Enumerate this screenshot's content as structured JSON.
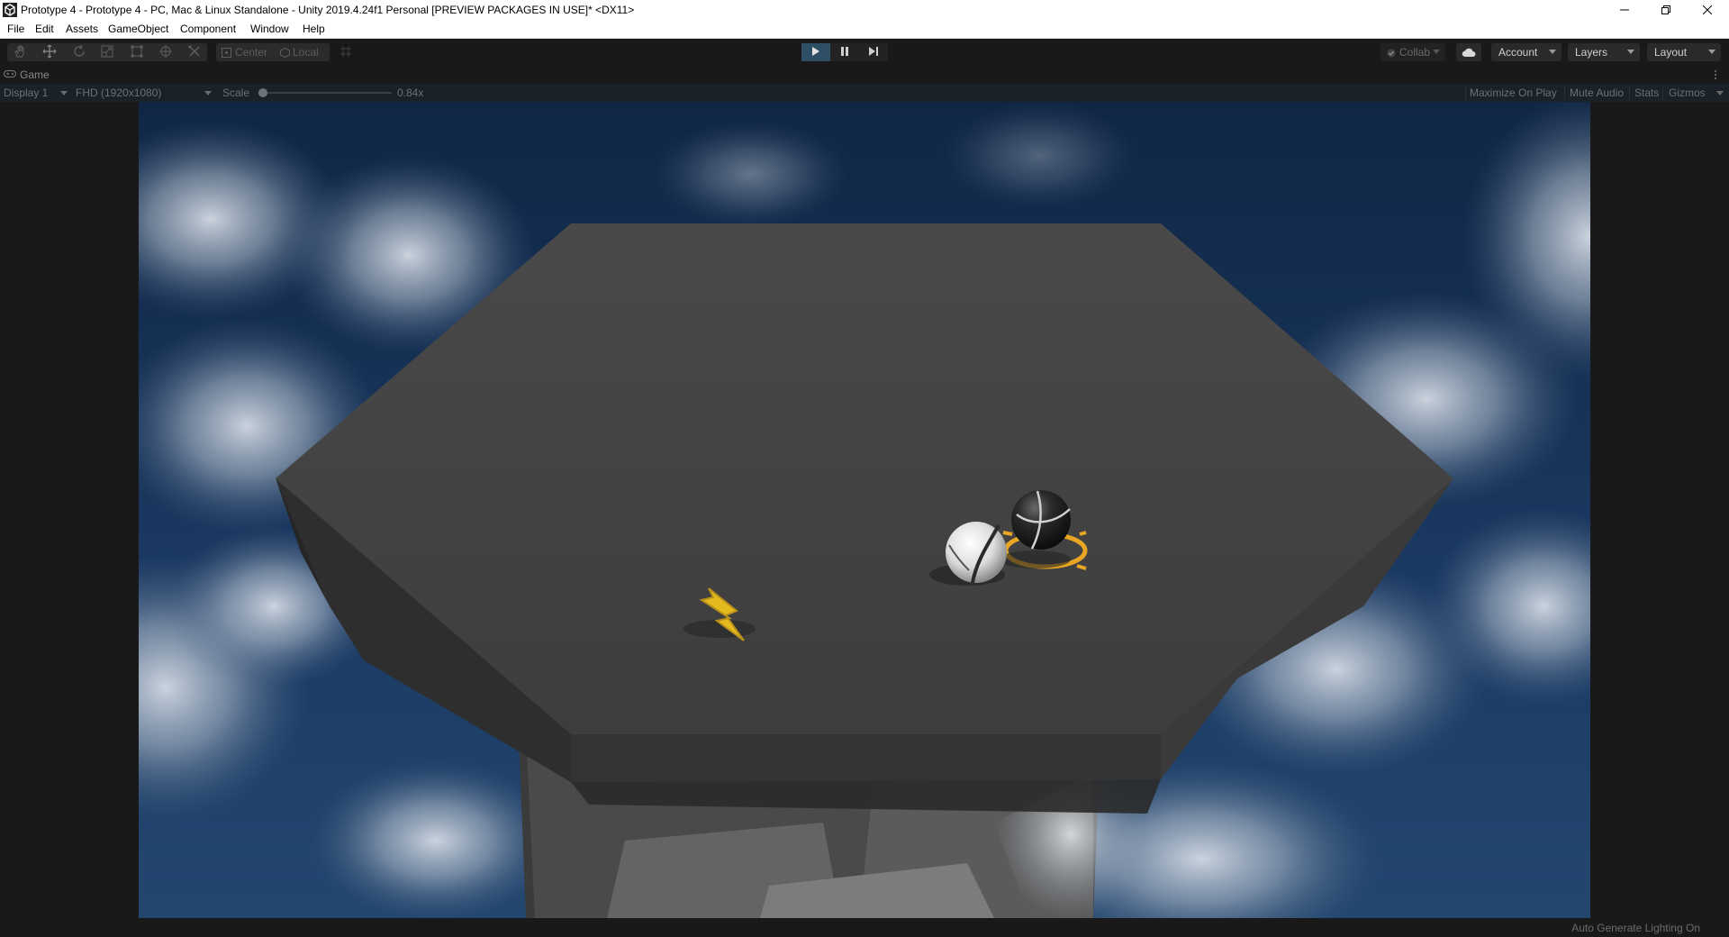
{
  "window": {
    "title": "Prototype 4 - Prototype 4 - PC, Mac & Linux Standalone - Unity 2019.4.24f1 Personal [PREVIEW PACKAGES IN USE]* <DX11>",
    "controls": [
      "minimize-icon",
      "restore-icon",
      "close-icon"
    ]
  },
  "menu": {
    "items": [
      "File",
      "Edit",
      "Assets",
      "GameObject",
      "Component",
      "Window",
      "Help"
    ]
  },
  "toolbar": {
    "tools": [
      "hand-icon",
      "move-icon",
      "rotate-icon",
      "scale-icon",
      "rect-icon",
      "transform-icon",
      "custom-tool-icon"
    ],
    "pivot_label": "Center",
    "space_label": "Local",
    "collab_label": "Collab",
    "account_label": "Account",
    "layers_label": "Layers",
    "layout_label": "Layout",
    "play_icons": [
      "play-icon",
      "pause-icon",
      "step-icon"
    ]
  },
  "game_tab": {
    "label": "Game"
  },
  "game_view": {
    "display_label": "Display 1",
    "resolution_label": "FHD (1920x1080)",
    "scale_label": "Scale",
    "scale_value_label": "0.84x",
    "scale_value": 0.84,
    "maximize_label": "Maximize On Play",
    "mute_label": "Mute Audio",
    "stats_label": "Stats",
    "gizmos_label": "Gizmos"
  },
  "status": {
    "message": "Auto Generate Lighting On"
  },
  "colors": {
    "editor_bg": "#191919",
    "sky_blue": "#18335a",
    "platform_top": "#434343",
    "ring_orange": "#e8a623",
    "powerup_yellow": "#e8c323",
    "play_active": "#2f4f66"
  }
}
